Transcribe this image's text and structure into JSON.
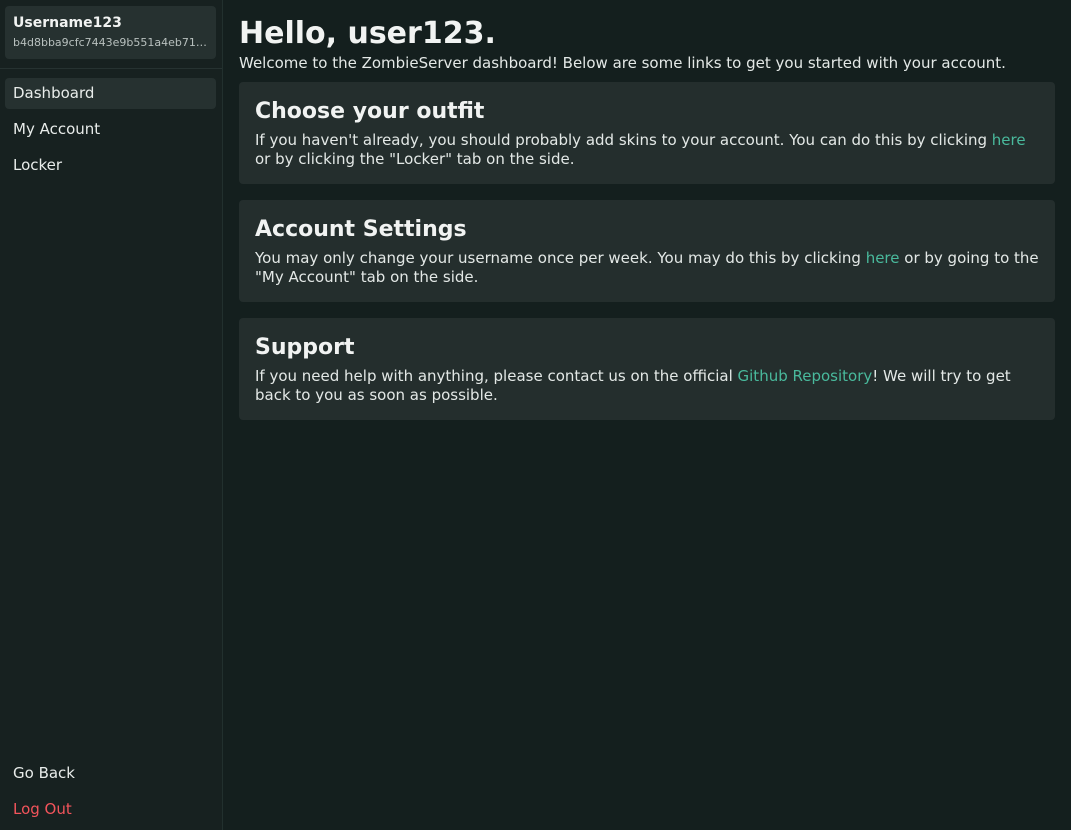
{
  "sidebar": {
    "user": {
      "name": "Username123",
      "id": "b4d8bba9cfc7443e9b551a4eb71ab2..."
    },
    "nav": [
      {
        "label": "Dashboard",
        "active": true
      },
      {
        "label": "My Account",
        "active": false
      },
      {
        "label": "Locker",
        "active": false
      }
    ],
    "bottom": {
      "go_back": "Go Back",
      "log_out": "Log Out"
    }
  },
  "main": {
    "title": "Hello, user123.",
    "welcome": "Welcome to the ZombieServer dashboard! Below are some links to get you started with your account.",
    "cards": [
      {
        "title": "Choose your outfit",
        "text_before": "If you haven't already, you should probably add skins to your account. You can do this by clicking ",
        "link": "here",
        "text_after": " or by clicking the \"Locker\" tab on the side."
      },
      {
        "title": "Account Settings",
        "text_before": "You may only change your username once per week. You may do this by clicking ",
        "link": "here",
        "text_after": " or by going to the \"My Account\" tab on the side."
      },
      {
        "title": "Support",
        "text_before": "If you need help with anything, please contact us on the official ",
        "link": "Github Repository",
        "text_after": "! We will try to get back to you as soon as possible."
      }
    ]
  },
  "colors": {
    "background": "#141f1e",
    "card": "#242e2d",
    "link": "#49b99c",
    "logout": "#f2545b"
  }
}
